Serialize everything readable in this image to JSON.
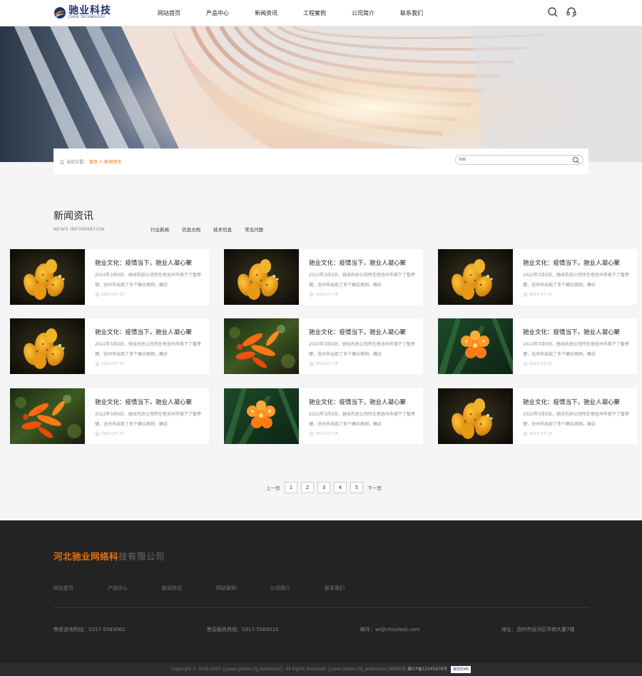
{
  "header": {
    "logo_name": "驰业科技",
    "logo_sub": "CHIYE TECHNOLOGY",
    "nav": [
      "网站首页",
      "产品中心",
      "新闻资讯",
      "工程案例",
      "公司简介",
      "联系我们"
    ],
    "icons": [
      "search-icon",
      "headset-icon"
    ]
  },
  "breadcrumb": {
    "prefix": "当前位置：",
    "home": "首页",
    "sep": ">",
    "current": "新闻资讯"
  },
  "search": {
    "placeholder": "搜索"
  },
  "section": {
    "title": "新闻资讯",
    "subtitle": "NEWS INFORMATION",
    "tabs": [
      "行业新闻",
      "信息文档",
      "技术信息",
      "常见问题"
    ]
  },
  "news": [
    {
      "title": "驰业文化：疫情当下，驰业人凝心聚",
      "desc": "2022年3月9日，驰业的总公司所在地沧州市按下了暂停键，沧州市出现了多个确诊病例，确诊",
      "date": "2022-07-15",
      "img": "orange-flower"
    },
    {
      "title": "驰业文化：疫情当下，驰业人凝心聚",
      "desc": "2022年3月9日，驰业的总公司所在地沧州市按下了暂停键，沧州市出现了多个确诊病例，确诊",
      "date": "2022-07-15",
      "img": "orange-flower"
    },
    {
      "title": "驰业文化：疫情当下，驰业人凝心聚",
      "desc": "2022年3月9日，驰业的总公司所在地沧州市按下了暂停键，沧州市出现了多个确诊病例，确诊",
      "date": "2022-07-15",
      "img": "orange-flower"
    },
    {
      "title": "驰业文化：疫情当下，驰业人凝心聚",
      "desc": "2022年3月9日，驰业的总公司所在地沧州市按下了暂停键，沧州市出现了多个确诊病例，确诊",
      "date": "2022-07-15",
      "img": "orange-flower"
    },
    {
      "title": "驰业文化：疫情当下，驰业人凝心聚",
      "desc": "2022年3月9日，驰业的总公司所在地沧州市按下了暂停键，沧州市出现了多个确诊病例，确诊",
      "date": "2022-07-15",
      "img": "trumpet-flower"
    },
    {
      "title": "驰业文化：疫情当下，驰业人凝心聚",
      "desc": "2022年3月9日，驰业的总公司所在地沧州市按下了暂停键，沧州市出现了多个确诊病例，确诊",
      "date": "2022-07-15",
      "img": "clivia-flower"
    },
    {
      "title": "驰业文化：疫情当下，驰业人凝心聚",
      "desc": "2022年3月9日，驰业的总公司所在地沧州市按下了暂停键，沧州市出现了多个确诊病例，确诊",
      "date": "2022-07-15",
      "img": "trumpet-flower"
    },
    {
      "title": "驰业文化：疫情当下，驰业人凝心聚",
      "desc": "2022年3月9日，驰业的总公司所在地沧州市按下了暂停键，沧州市出现了多个确诊病例，确诊",
      "date": "2022-07-15",
      "img": "clivia-flower"
    },
    {
      "title": "驰业文化：疫情当下，驰业人凝心聚",
      "desc": "2022年3月9日，驰业的总公司所在地沧州市按下了暂停键，沧州市出现了多个确诊病例，确诊",
      "date": "2022-07-15",
      "img": "orange-flower"
    }
  ],
  "pagination": {
    "prev": "上一页",
    "pages": [
      "1",
      "2",
      "3",
      "4",
      "5"
    ],
    "next": "下一页"
  },
  "footer": {
    "company_highlight": "河北驰业网络科",
    "company_rest": "技有限公司",
    "nav": [
      "网站首页",
      "产品中心",
      "新闻资讯",
      "网站案例",
      "公司简介",
      "联系我们"
    ],
    "sales_hotline": "售前咨询热线：0317-5563062",
    "service_hotline": "售后服务热线：0317-5563010",
    "email": "邮件：wl@chiyekeji.com",
    "address": "地址：沧州市运河区华商大厦7楼",
    "copyright": "Copyright © 2019-2020 {ysseo:global.cfg_basehost/}. All Rights Reserved {ysseo:global.cfg_webname/}版权所有",
    "beian": "冀ICP备12345678号",
    "badge": "易优EIMS"
  },
  "colors": {
    "accent": "#e8720c",
    "brand": "#1e3270",
    "footer_bg": "#232323"
  }
}
